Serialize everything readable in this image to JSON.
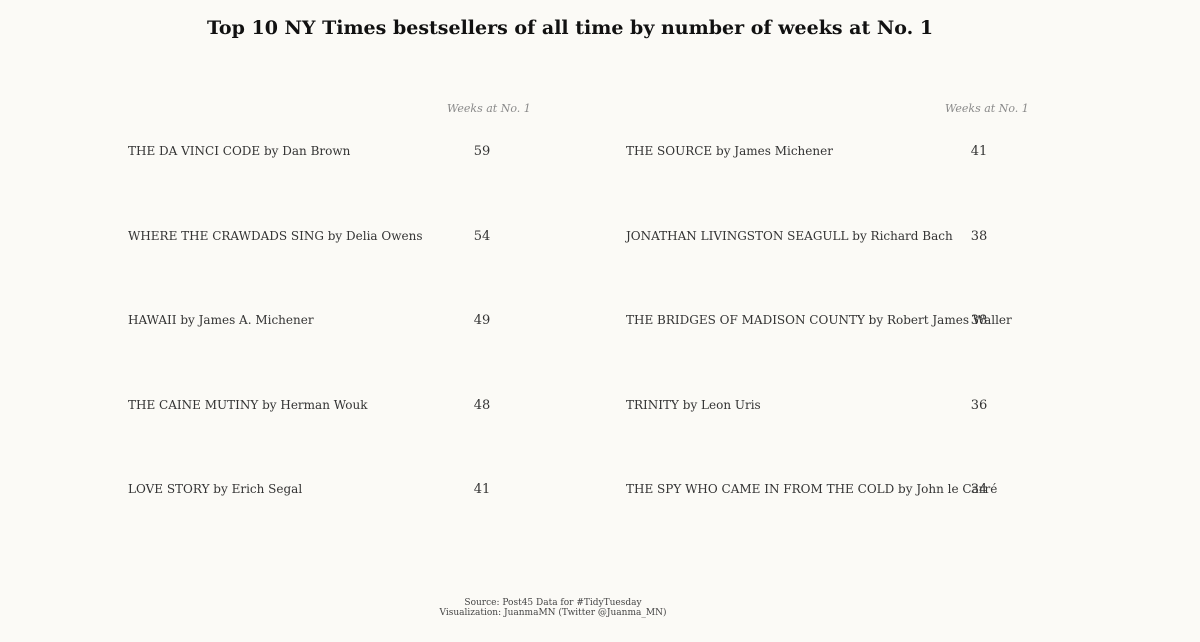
{
  "title": "Top 10 NY Times bestsellers of all time by number of weeks at No. 1",
  "column_header": "Weeks at No. 1",
  "chart_data": {
    "type": "table",
    "title": "Top 10 NY Times bestsellers of all time by number of weeks at No. 1",
    "column_header": "Weeks at No. 1",
    "rows": [
      {
        "label": "THE DA VINCI CODE by Dan Brown",
        "weeks": 59
      },
      {
        "label": "WHERE THE CRAWDADS SING by Delia Owens",
        "weeks": 54
      },
      {
        "label": "HAWAII by James A. Michener",
        "weeks": 49
      },
      {
        "label": "THE CAINE MUTINY by Herman Wouk",
        "weeks": 48
      },
      {
        "label": "LOVE STORY by Erich Segal",
        "weeks": 41
      },
      {
        "label": "THE SOURCE by James Michener",
        "weeks": 41
      },
      {
        "label": "JONATHAN LIVINGSTON SEAGULL by Richard Bach",
        "weeks": 38
      },
      {
        "label": "THE BRIDGES OF MADISON COUNTY by Robert James Waller",
        "weeks": 38
      },
      {
        "label": "TRINITY by Leon Uris",
        "weeks": 36
      },
      {
        "label": "THE SPY WHO CAME IN FROM THE COLD by John le Carré",
        "weeks": 34
      }
    ]
  },
  "caption": {
    "line1": "Source: Post45 Data for #TidyTuesday",
    "line2": "Visualization: JuanmaMN (Twitter @Juanma_MN)"
  }
}
